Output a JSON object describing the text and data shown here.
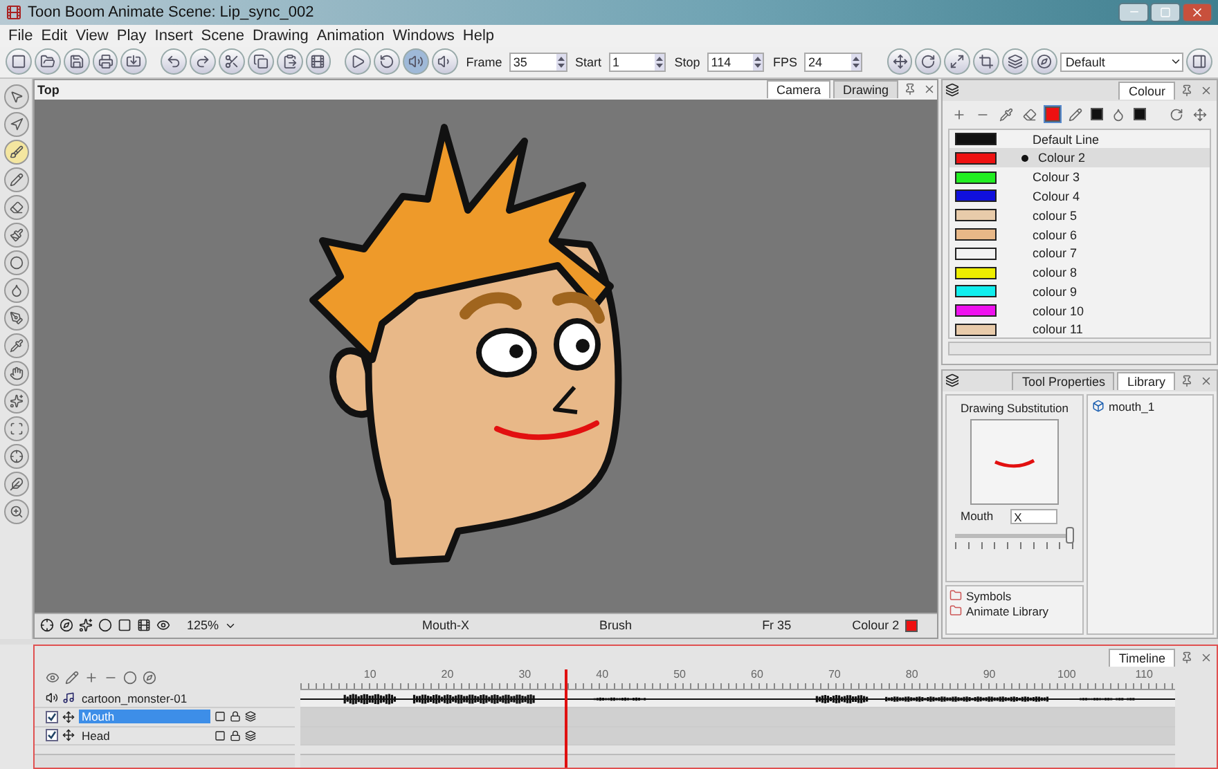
{
  "window": {
    "title": "Toon Boom Animate Scene: Lip_sync_002"
  },
  "menu": [
    "File",
    "Edit",
    "View",
    "Play",
    "Insert",
    "Scene",
    "Drawing",
    "Animation",
    "Windows",
    "Help"
  ],
  "playback": [
    {
      "label": "Frame",
      "value": "35"
    },
    {
      "label": "Start",
      "value": "1"
    },
    {
      "label": "Stop",
      "value": "114"
    },
    {
      "label": "FPS",
      "value": "24"
    }
  ],
  "sound_scrub": {
    "on": true
  },
  "workspace": {
    "value": "Default"
  },
  "viewport": {
    "view": "Top",
    "tabs": [
      {
        "label": "Camera",
        "selected": true
      },
      {
        "label": "Drawing",
        "selected": false
      }
    ]
  },
  "status_bar": {
    "zoom": "125%",
    "drawing": "Mouth-X",
    "tool": "Brush",
    "frame": "Fr 35",
    "colour": "Colour 2"
  },
  "colour_panel": {
    "tab": "Colour",
    "items": [
      {
        "name": "Default Line",
        "color": "#111111",
        "selected": false
      },
      {
        "name": "Colour 2",
        "color": "#ee1111",
        "selected": true
      },
      {
        "name": "Colour 3",
        "color": "#22ee22",
        "selected": false
      },
      {
        "name": "Colour 4",
        "color": "#1010dd",
        "selected": false
      },
      {
        "name": "colour 5",
        "color": "#e8cbaa",
        "selected": false
      },
      {
        "name": "colour 6",
        "color": "#e8b888",
        "selected": false
      },
      {
        "name": "colour 7",
        "color": "#f2f2f2",
        "selected": false
      },
      {
        "name": "colour 8",
        "color": "#eeee00",
        "selected": false
      },
      {
        "name": "colour 9",
        "color": "#11eeee",
        "selected": false
      },
      {
        "name": "colour 10",
        "color": "#ee11ee",
        "selected": false
      },
      {
        "name": "colour 11",
        "color": "#e8cbaa",
        "selected": false
      }
    ]
  },
  "lower_panel": {
    "tabs": [
      {
        "label": "Tool Properties",
        "selected": false
      },
      {
        "label": "Library",
        "selected": true
      }
    ],
    "substitution": {
      "title": "Drawing Substitution",
      "layer": "Mouth",
      "value": "X",
      "level": 1
    },
    "library_tree": [
      {
        "label": "Symbols"
      },
      {
        "label": "Animate Library"
      }
    ],
    "library_items": [
      "mouth_1"
    ]
  },
  "timeline": {
    "tab": "Timeline",
    "ticks": [
      "10",
      "20",
      "30",
      "40",
      "50",
      "60",
      "70",
      "80",
      "90",
      "100",
      "110"
    ],
    "playhead": {
      "level": 0.3
    },
    "layers": [
      {
        "kind": "sound",
        "name": "cartoon_monster-01"
      },
      {
        "kind": "drawing",
        "name": "Mouth",
        "checked": true,
        "selected": true
      },
      {
        "kind": "drawing",
        "name": "Head",
        "checked": true,
        "selected": false
      }
    ]
  }
}
